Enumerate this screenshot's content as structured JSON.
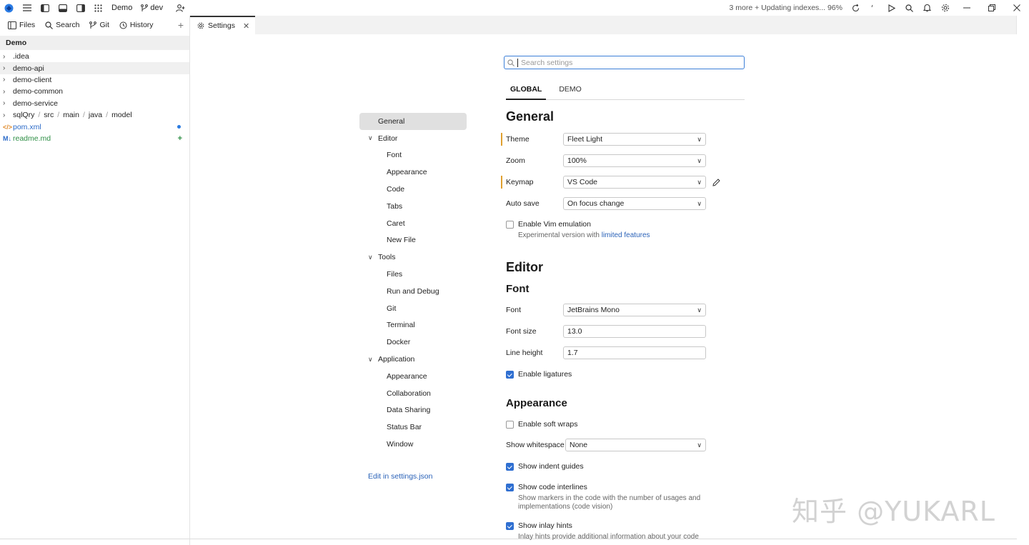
{
  "titlebar": {
    "project": "Demo",
    "branch": "dev",
    "status": "3 more + Updating indexes... 96%"
  },
  "left_tabs": [
    {
      "label": "Files",
      "icon": "files-icon"
    },
    {
      "label": "Search",
      "icon": "search-icon"
    },
    {
      "label": "Git",
      "icon": "git-icon"
    },
    {
      "label": "History",
      "icon": "history-icon"
    }
  ],
  "tree": {
    "root": "Demo",
    "items": [
      {
        "label": ".idea"
      },
      {
        "label": "demo-api"
      },
      {
        "label": "demo-client"
      },
      {
        "label": "demo-common"
      },
      {
        "label": "demo-service"
      },
      {
        "parts": [
          "sqlQry",
          "src",
          "main",
          "java",
          "model"
        ],
        "sep": "/"
      },
      {
        "label": "pom.xml",
        "status": "modified"
      },
      {
        "label": "readme.md",
        "status": "added"
      }
    ]
  },
  "editor_tab": {
    "label": "Settings"
  },
  "search": {
    "placeholder": "Search settings"
  },
  "scopes": [
    "GLOBAL",
    "DEMO"
  ],
  "nav": {
    "general": "General",
    "editor": {
      "label": "Editor",
      "items": [
        "Font",
        "Appearance",
        "Code",
        "Tabs",
        "Caret",
        "New File"
      ]
    },
    "tools": {
      "label": "Tools",
      "items": [
        "Files",
        "Run and Debug",
        "Git",
        "Terminal",
        "Docker"
      ]
    },
    "application": {
      "label": "Application",
      "items": [
        "Appearance",
        "Collaboration",
        "Data Sharing",
        "Status Bar",
        "Window"
      ]
    },
    "edit_json": "Edit in settings.json"
  },
  "general": {
    "heading": "General",
    "theme": {
      "label": "Theme",
      "value": "Fleet Light"
    },
    "zoom": {
      "label": "Zoom",
      "value": "100%"
    },
    "keymap": {
      "label": "Keymap",
      "value": "VS Code"
    },
    "autosave": {
      "label": "Auto save",
      "value": "On focus change"
    },
    "vim": {
      "label": "Enable Vim emulation",
      "desc": "Experimental version with ",
      "link": "limited features",
      "checked": false
    }
  },
  "editor": {
    "heading": "Editor",
    "font_heading": "Font",
    "font": {
      "label": "Font",
      "value": "JetBrains Mono"
    },
    "font_size": {
      "label": "Font size",
      "value": "13.0"
    },
    "line_height": {
      "label": "Line height",
      "value": "1.7"
    },
    "ligatures": {
      "label": "Enable ligatures",
      "checked": true
    },
    "appearance_heading": "Appearance",
    "soft_wraps": {
      "label": "Enable soft wraps",
      "checked": false
    },
    "whitespace": {
      "label": "Show whitespace",
      "value": "None"
    },
    "indent_guides": {
      "label": "Show indent guides",
      "checked": true
    },
    "code_interlines": {
      "label": "Show code interlines",
      "desc": "Show markers in the code with the number of usages and implementations (code vision)",
      "checked": true
    },
    "inlay_hints": {
      "label": "Show inlay hints",
      "desc": "Inlay hints provide additional information about your code",
      "checked": true
    }
  },
  "watermark": "知乎 @YUKARL",
  "colors": {
    "accent": "#2f6fd1",
    "modified_marker": "#e0a030",
    "added": "#2f8f46"
  }
}
